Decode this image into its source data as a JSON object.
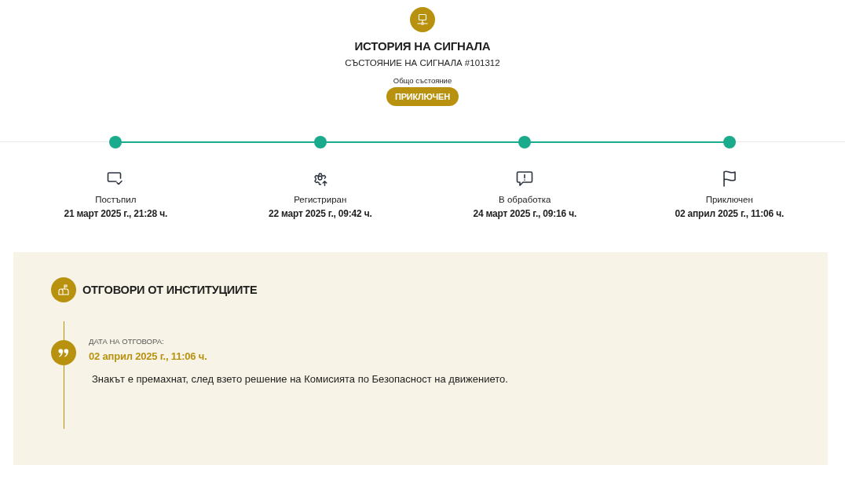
{
  "header": {
    "title": "ИСТОРИЯ НА СИГНАЛА",
    "subtitle": "СЪСТОЯНИЕ НА СИГНАЛА #101312",
    "status_label": "Общо състояние",
    "status": "ПРИКЛЮЧЕН"
  },
  "stages": [
    {
      "kind": "received",
      "label": "Постъпил",
      "date": "21 март 2025 г., 21:28 ч.",
      "done": true
    },
    {
      "kind": "registered",
      "label": "Регистриран",
      "date": "22 март 2025 г., 09:42 ч.",
      "done": true
    },
    {
      "kind": "processing",
      "label": "В обработка",
      "date": "24 март 2025 г., 09:16 ч.",
      "done": true
    },
    {
      "kind": "closed",
      "label": "Приключен",
      "date": "02 април 2025 г., 11:06 ч.",
      "done": true
    }
  ],
  "responses": {
    "title": "ОТГОВОРИ ОТ ИНСТИТУЦИИТЕ",
    "items": [
      {
        "date_label": "ДАТА НА ОТГОВОРА:",
        "date": "02 април 2025 г., 11:06 ч.",
        "text": "Знакът е премахнат, след взето решение на Комисията по Безопасност на движението."
      }
    ]
  }
}
